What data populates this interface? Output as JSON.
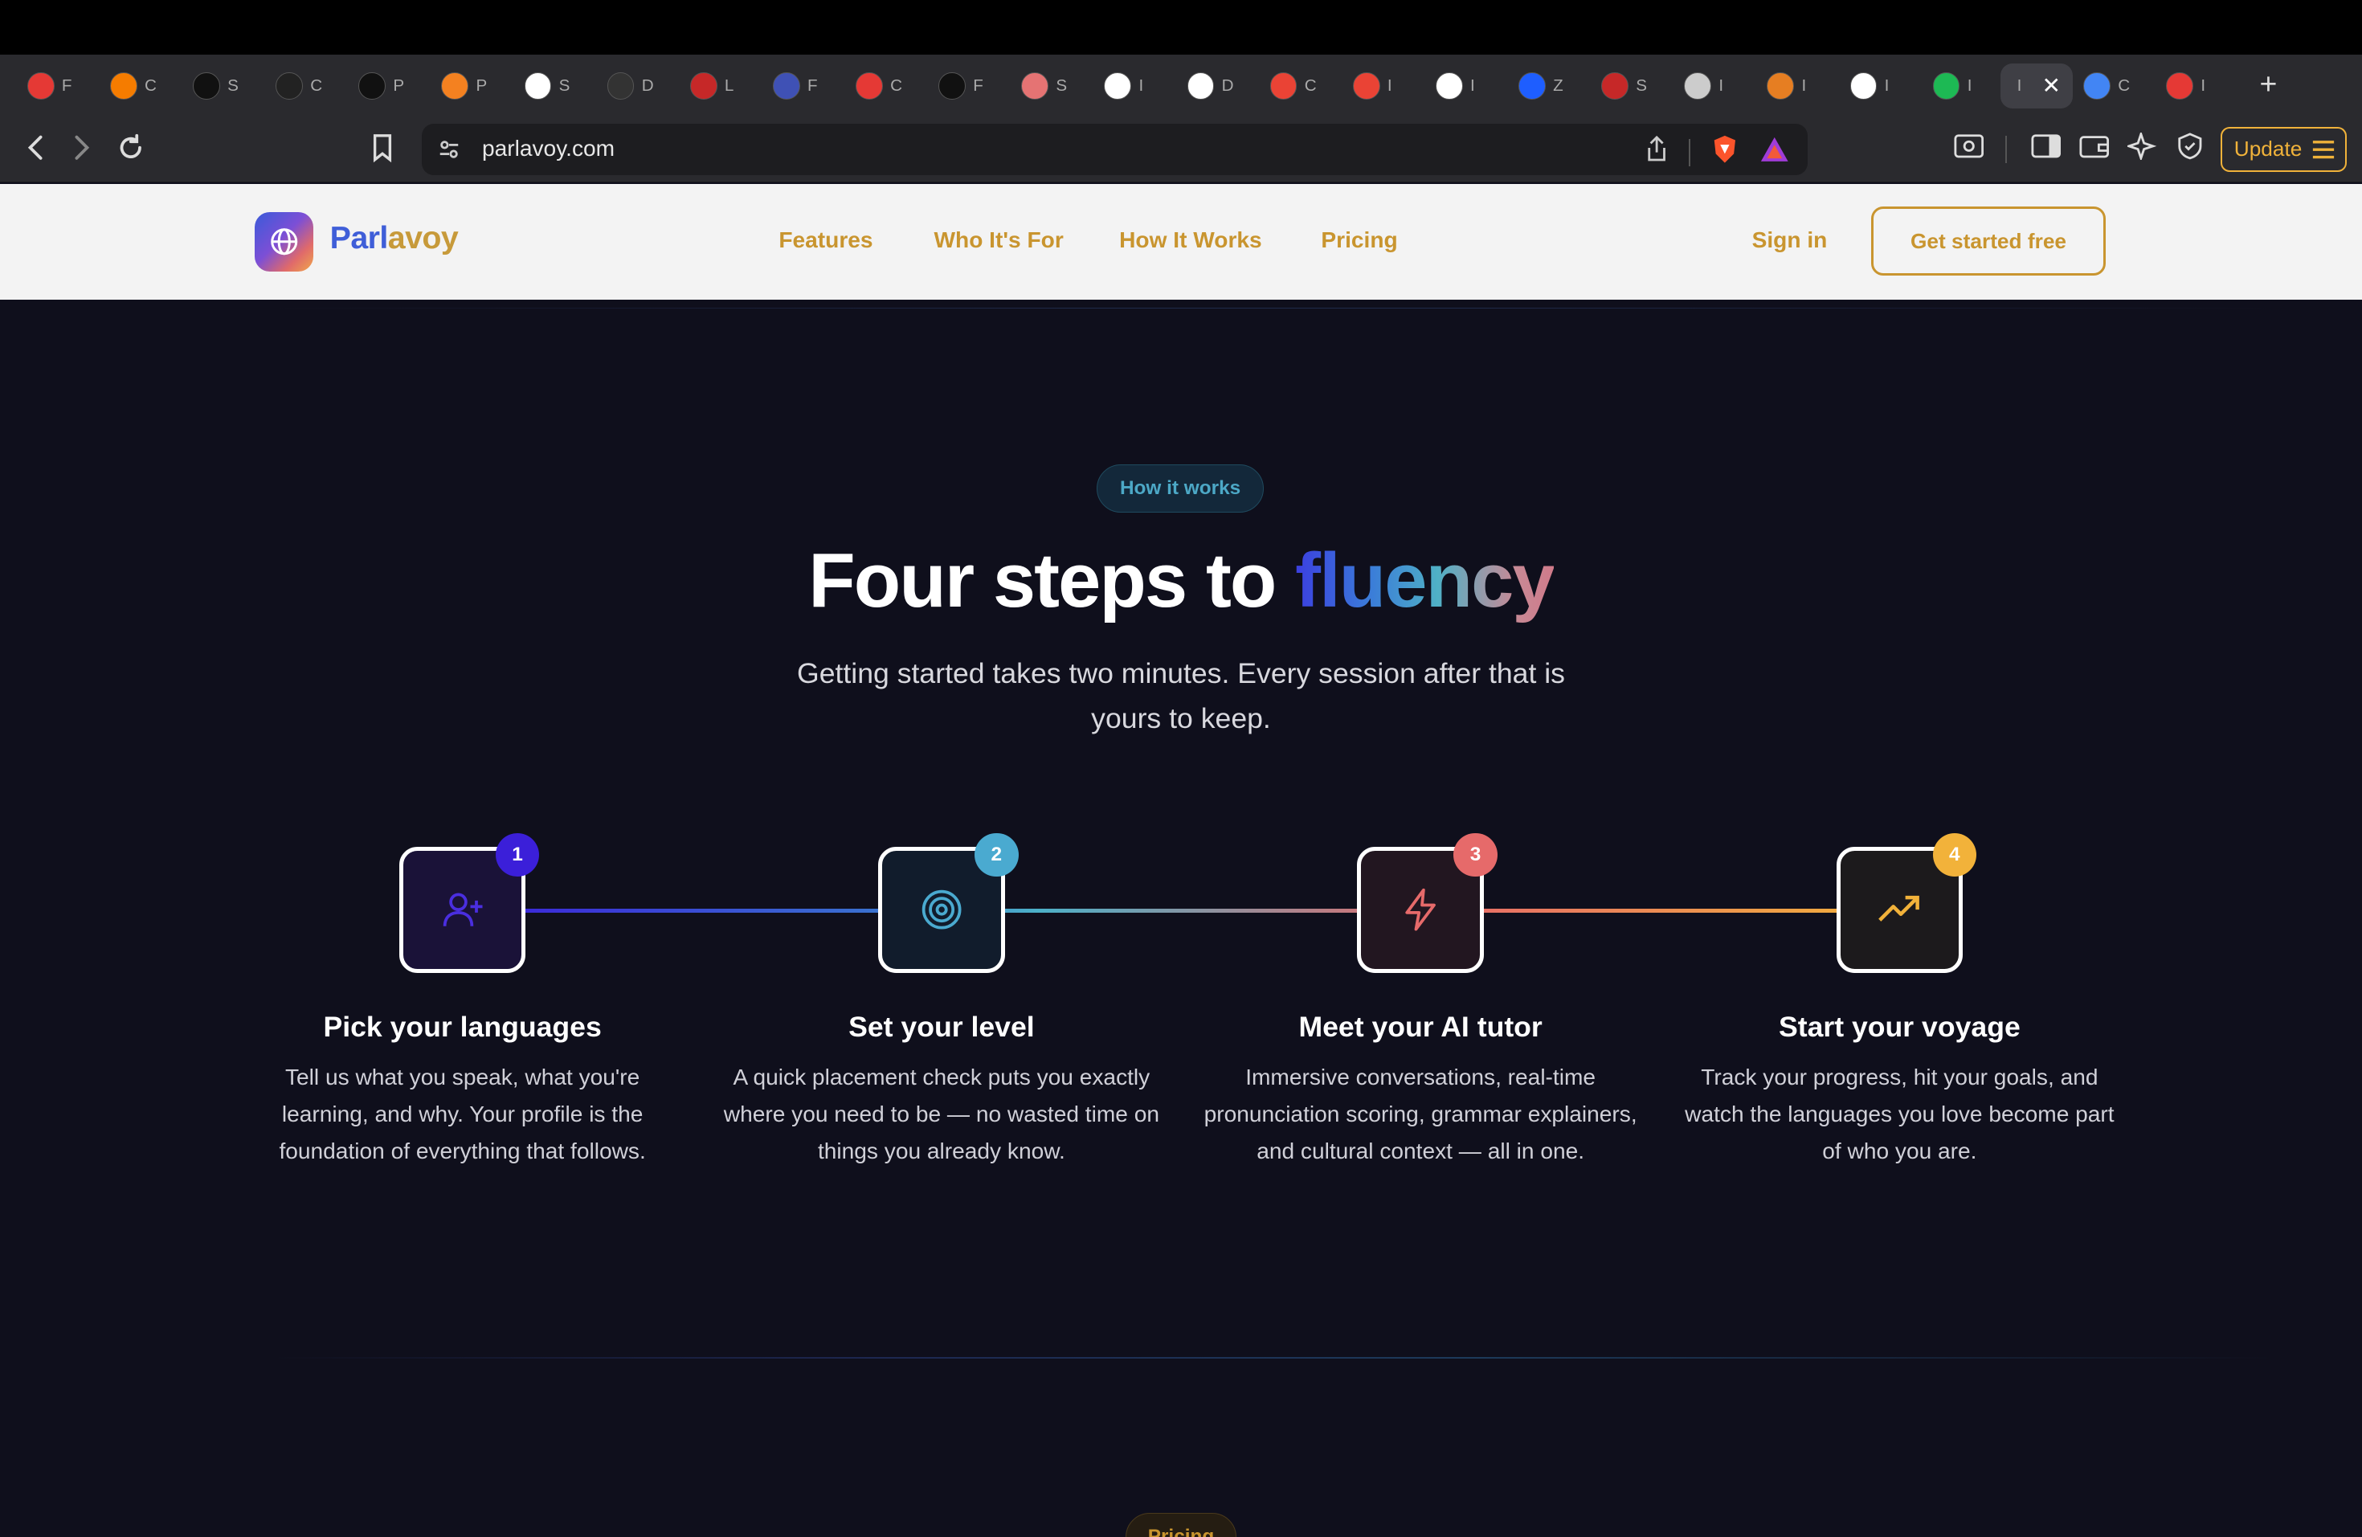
{
  "browser": {
    "tabs": [
      {
        "icon": "tab-favicon",
        "letter": "F",
        "color": "#e53935"
      },
      {
        "icon": "tab-favicon",
        "letter": "C",
        "color": "#f57c00"
      },
      {
        "icon": "tab-favicon",
        "letter": "S",
        "color": "#111111"
      },
      {
        "icon": "github-icon",
        "letter": "C",
        "color": "#222222"
      },
      {
        "icon": "tab-favicon",
        "letter": "P",
        "color": "#111111"
      },
      {
        "icon": "cloud-icon",
        "letter": "P",
        "color": "#f48120"
      },
      {
        "icon": "tab-favicon",
        "letter": "S",
        "color": "#ffffff"
      },
      {
        "icon": "tab-favicon",
        "letter": "D",
        "color": "#333333"
      },
      {
        "icon": "tab-favicon",
        "letter": "L",
        "color": "#c62828"
      },
      {
        "icon": "tab-favicon",
        "letter": "F",
        "color": "#3f51b5"
      },
      {
        "icon": "tab-favicon",
        "letter": "C",
        "color": "#e53935"
      },
      {
        "icon": "tab-favicon",
        "letter": "F",
        "color": "#111111"
      },
      {
        "icon": "star-icon",
        "letter": "S",
        "color": "#e57373"
      },
      {
        "icon": "tab-favicon",
        "letter": "I",
        "color": "#ffffff"
      },
      {
        "icon": "tab-favicon",
        "letter": "D",
        "color": "#ffffff"
      },
      {
        "icon": "gmail-icon",
        "letter": "C",
        "color": "#ea4335"
      },
      {
        "icon": "gmail-icon",
        "letter": "I",
        "color": "#ea4335"
      },
      {
        "icon": "tab-favicon",
        "letter": "I",
        "color": "#ffffff"
      },
      {
        "icon": "tab-favicon",
        "letter": "Z",
        "color": "#1e5eff"
      },
      {
        "icon": "tab-favicon",
        "letter": "S",
        "color": "#c62828"
      },
      {
        "icon": "globe-icon",
        "letter": "I",
        "color": "#cccccc"
      },
      {
        "icon": "tab-favicon",
        "letter": "I",
        "color": "#e67e22"
      },
      {
        "icon": "apple-icon",
        "letter": "I",
        "color": "#ffffff"
      },
      {
        "icon": "spotify-icon",
        "letter": "I",
        "color": "#1db954"
      },
      {
        "icon": "tab-favicon",
        "letter": "I",
        "color": "#3f3f45",
        "active": true
      },
      {
        "icon": "translate-icon",
        "letter": "C",
        "color": "#4285f4"
      },
      {
        "icon": "tab-favicon",
        "letter": "I",
        "color": "#e53935"
      }
    ],
    "url": "parlavoy.com",
    "update_label": "Update"
  },
  "site": {
    "logo_part1": "Parl",
    "logo_part2": "avoy",
    "nav": [
      "Features",
      "Who It's For",
      "How It Works",
      "Pricing"
    ],
    "signin": "Sign in",
    "cta": "Get started free"
  },
  "section": {
    "pill": "How it works",
    "headline_plain": "Four steps to ",
    "headline_accent": "fluency",
    "subtitle": "Getting started takes two minutes. Every session after that is yours to keep."
  },
  "steps": [
    {
      "number": "1",
      "title": "Pick your languages",
      "desc": "Tell us what you speak, what you're learning, and why. Your profile is the foundation of everything that follows.",
      "icon": "user-plus-icon",
      "accent": "#3b1fd9",
      "bg": "#1a1238"
    },
    {
      "number": "2",
      "title": "Set your level",
      "desc": "A quick placement check puts you exactly where you need to be — no wasted time on things you already know.",
      "icon": "target-icon",
      "accent": "#4aaad0",
      "bg": "#111c2c"
    },
    {
      "number": "3",
      "title": "Meet your AI tutor",
      "desc": "Immersive conversations, real-time pronunciation scoring, grammar explainers, and cultural context — all in one.",
      "icon": "lightning-icon",
      "accent": "#e66a6a",
      "bg": "#221620"
    },
    {
      "number": "4",
      "title": "Start your voyage",
      "desc": "Track your progress, hit your goals, and watch the languages you love become part of who you are.",
      "icon": "trending-up-icon",
      "accent": "#f2b23a",
      "bg": "#1c1a1c"
    }
  ],
  "next_section": {
    "pill": "Pricing"
  }
}
